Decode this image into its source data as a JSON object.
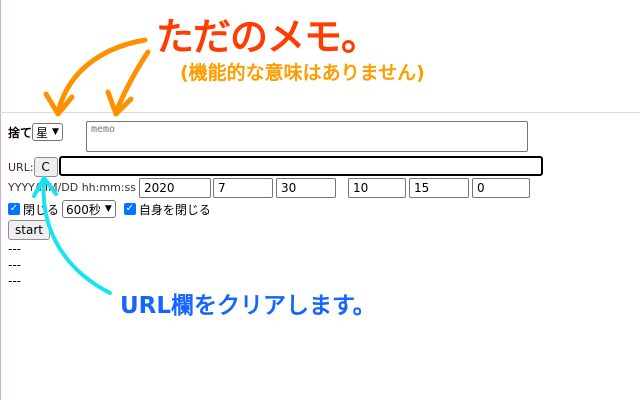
{
  "annotations": {
    "title": "ただのメモ。",
    "subtitle": "(機能的な意味はありません)",
    "url_note": "URL欄をクリアします。"
  },
  "row1": {
    "label": "捨て",
    "select_value": "星",
    "memo_placeholder": "memo"
  },
  "row2": {
    "label": "URL:",
    "clear_button": "C",
    "url_value": ""
  },
  "row3": {
    "label": "YYYY/MM/DD hh:mm:ss",
    "year": "2020",
    "month": "7",
    "day": "30",
    "hour": "10",
    "minute": "15",
    "second": "0"
  },
  "row4": {
    "close_label": "閉じる",
    "close_checked": true,
    "timeout_value": "600秒",
    "self_close_label": "自身を閉じる",
    "self_close_checked": true
  },
  "start_button": "start",
  "output_lines": [
    "---",
    "---",
    "---"
  ],
  "colors": {
    "title": "#ff3d00",
    "subtitle": "#ff9d00",
    "url_note": "#1565ff",
    "orange_arrow": "#ff9100",
    "cyan_arrow": "#19e3ee",
    "checkbox": "#0075ff"
  }
}
